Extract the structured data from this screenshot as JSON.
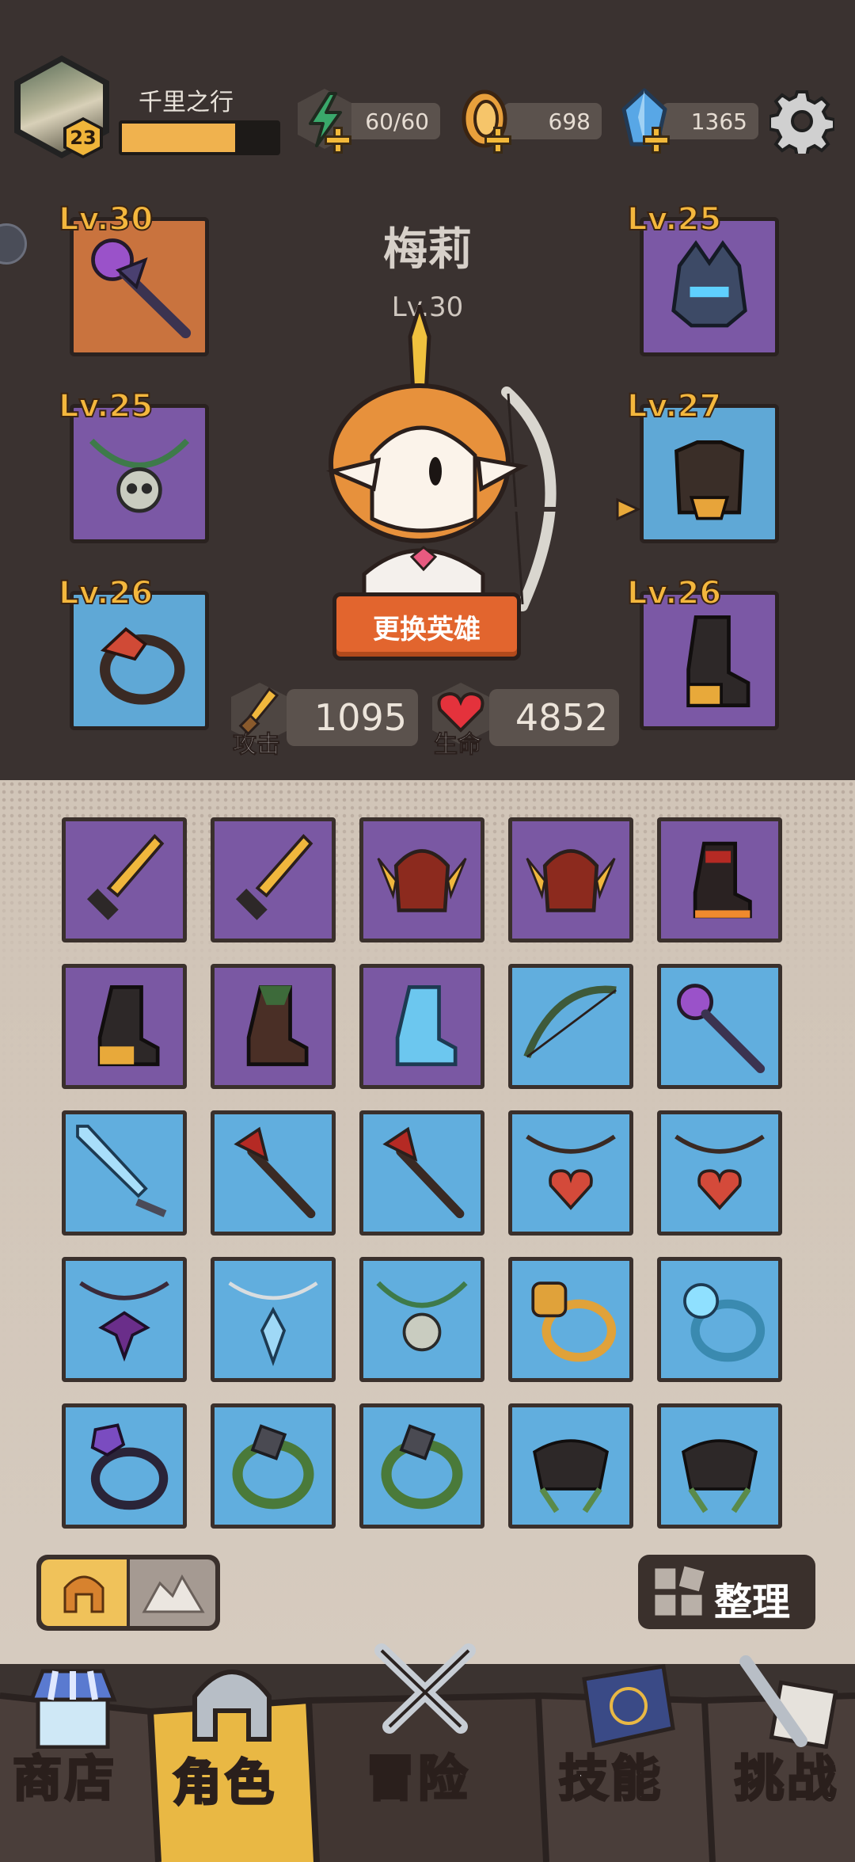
{
  "player": {
    "name": "千里之行",
    "level": "23",
    "xp_fraction": 0.73
  },
  "resources": {
    "energy": {
      "icon": "lightning-icon",
      "value": "60/60"
    },
    "gold": {
      "icon": "coin-icon",
      "value": "698"
    },
    "gems": {
      "icon": "crystal-icon",
      "value": "1365"
    }
  },
  "hero": {
    "name": "梅莉",
    "level": "Lv.30",
    "swap_label": "更换英雄"
  },
  "equipped": {
    "weapon": {
      "level": "Lv.30",
      "icon": "staff-icon"
    },
    "helmet": {
      "level": "Lv.25",
      "icon": "helmet-icon"
    },
    "necklace": {
      "level": "Lv.25",
      "icon": "skull-necklace-icon"
    },
    "armor": {
      "level": "Lv.27",
      "icon": "armor-icon"
    },
    "ring": {
      "level": "Lv.26",
      "icon": "ring-icon"
    },
    "boots": {
      "level": "Lv.26",
      "icon": "boots-icon"
    }
  },
  "stats": {
    "attack": {
      "label": "攻击",
      "value": "1095"
    },
    "hp": {
      "label": "生命",
      "value": "4852"
    }
  },
  "inventory_controls": {
    "sort_label": "整理"
  },
  "nav": {
    "shop": "商店",
    "character": "角色",
    "adventure": "冒险",
    "skills": "技能",
    "challenge": "挑战"
  },
  "colors": {
    "accent": "#f0b53a",
    "swap_button": "#e2652e",
    "rare": "#7a58a3",
    "common": "#61aede"
  }
}
